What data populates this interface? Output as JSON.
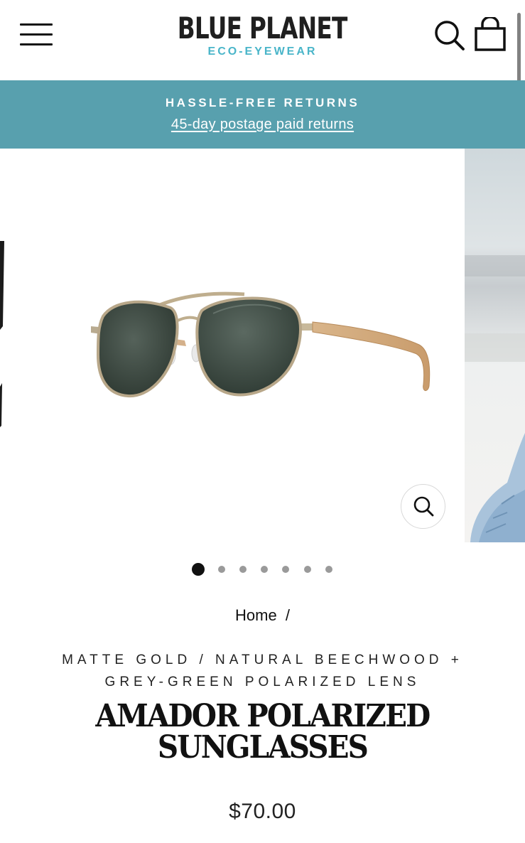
{
  "header": {
    "logo_main": "BLUE PLANET",
    "logo_sub": "ECO-EYEWEAR",
    "menu_icon": "hamburger-menu-icon",
    "search_icon": "search-icon",
    "cart_icon": "shopping-bag-icon",
    "brand_accent": "#49b5c9"
  },
  "announcement": {
    "title": "HASSLE-FREE RETURNS",
    "link": "45-day postage paid returns",
    "background": "#58a0ae"
  },
  "gallery": {
    "zoom_icon": "magnifier-zoom-icon",
    "dot_count": 7,
    "active_dot": 1
  },
  "product": {
    "breadcrumb_home": "Home",
    "breadcrumb_separator": "/",
    "variant": "MATTE GOLD / NATURAL BEECHWOOD + GREY-GREEN POLARIZED LENS",
    "title_line1": "AMADOR POLARIZED",
    "title_line2": "SUNGLASSES",
    "price": "$70.00"
  }
}
